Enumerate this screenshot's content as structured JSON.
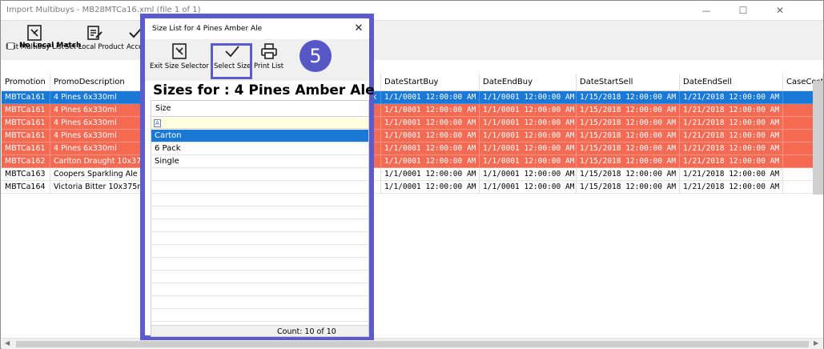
{
  "window": {
    "title": "Import Multibuys - MB28MTCa16.xml (file 1 of 1)",
    "minimize": "—",
    "maximize": "☐",
    "close": "✕"
  },
  "toolbar": {
    "exit_label": "Exit Multibuy List",
    "set_local_label": "Set Local Product",
    "accept_label": "Acce"
  },
  "no_local_match": "No Local Match",
  "grid": {
    "headers": [
      "Promotion",
      "PromoDescription",
      "DateStartBuy",
      "DateEndBuy",
      "DateStartSell",
      "DateEndSell",
      "CaseCost"
    ],
    "rows": [
      {
        "style": "sel",
        "promo": "MBTCa161",
        "desc": "4 Pines 6x330ml",
        "extra": "k",
        "start_buy": "1/1/0001 12:00:00 AM",
        "end_buy": "1/1/0001 12:00:00 AM",
        "start_sell": "1/15/2018 12:00:00 AM",
        "end_sell": "1/21/2018 12:00:00 AM"
      },
      {
        "style": "red",
        "promo": "MBTCa161",
        "desc": "4 Pines 6x330ml",
        "extra": "",
        "start_buy": "1/1/0001 12:00:00 AM",
        "end_buy": "1/1/0001 12:00:00 AM",
        "start_sell": "1/15/2018 12:00:00 AM",
        "end_sell": "1/21/2018 12:00:00 AM"
      },
      {
        "style": "red",
        "promo": "MBTCa161",
        "desc": "4 Pines 6x330ml",
        "extra": "",
        "start_buy": "1/1/0001 12:00:00 AM",
        "end_buy": "1/1/0001 12:00:00 AM",
        "start_sell": "1/15/2018 12:00:00 AM",
        "end_sell": "1/21/2018 12:00:00 AM"
      },
      {
        "style": "red",
        "promo": "MBTCa161",
        "desc": "4 Pines 6x330ml",
        "extra": "",
        "start_buy": "1/1/0001 12:00:00 AM",
        "end_buy": "1/1/0001 12:00:00 AM",
        "start_sell": "1/15/2018 12:00:00 AM",
        "end_sell": "1/21/2018 12:00:00 AM"
      },
      {
        "style": "red",
        "promo": "MBTCa161",
        "desc": "4 Pines 6x330ml",
        "extra": "",
        "start_buy": "1/1/0001 12:00:00 AM",
        "end_buy": "1/1/0001 12:00:00 AM",
        "start_sell": "1/15/2018 12:00:00 AM",
        "end_sell": "1/21/2018 12:00:00 AM"
      },
      {
        "style": "red",
        "promo": "MBTCa162",
        "desc": "Carlton Draught 10x37",
        "extra": "",
        "start_buy": "1/1/0001 12:00:00 AM",
        "end_buy": "1/1/0001 12:00:00 AM",
        "start_sell": "1/15/2018 12:00:00 AM",
        "end_sell": "1/21/2018 12:00:00 AM"
      },
      {
        "style": "",
        "promo": "MBTCa163",
        "desc": "Coopers Sparkling Ale",
        "extra": "",
        "start_buy": "1/1/0001 12:00:00 AM",
        "end_buy": "1/1/0001 12:00:00 AM",
        "start_sell": "1/15/2018 12:00:00 AM",
        "end_sell": "1/21/2018 12:00:00 AM"
      },
      {
        "style": "",
        "promo": "MBTCa164",
        "desc": "Victoria Bitter 10x375m",
        "extra": "",
        "start_buy": "1/1/0001 12:00:00 AM",
        "end_buy": "1/1/0001 12:00:00 AM",
        "start_sell": "1/15/2018 12:00:00 AM",
        "end_sell": "1/21/2018 12:00:00 AM"
      }
    ]
  },
  "dialog": {
    "title": "Size List for 4 Pines Amber Ale",
    "close": "✕",
    "exit_label": "Exit Size Selector",
    "select_label": "Select Size",
    "print_label": "Print List",
    "step_badge": "5",
    "heading": "Sizes for : 4 Pines Amber Ale",
    "column_header": "Size",
    "filter_icon": "A",
    "sizes": [
      "Carton",
      "6 Pack",
      "Single"
    ],
    "selected_index": 0,
    "count_text": "Count: 10 of 10"
  },
  "colors": {
    "selection": "#1a78d6",
    "warning_row": "#f46a52",
    "highlight": "#5b5bcf"
  }
}
